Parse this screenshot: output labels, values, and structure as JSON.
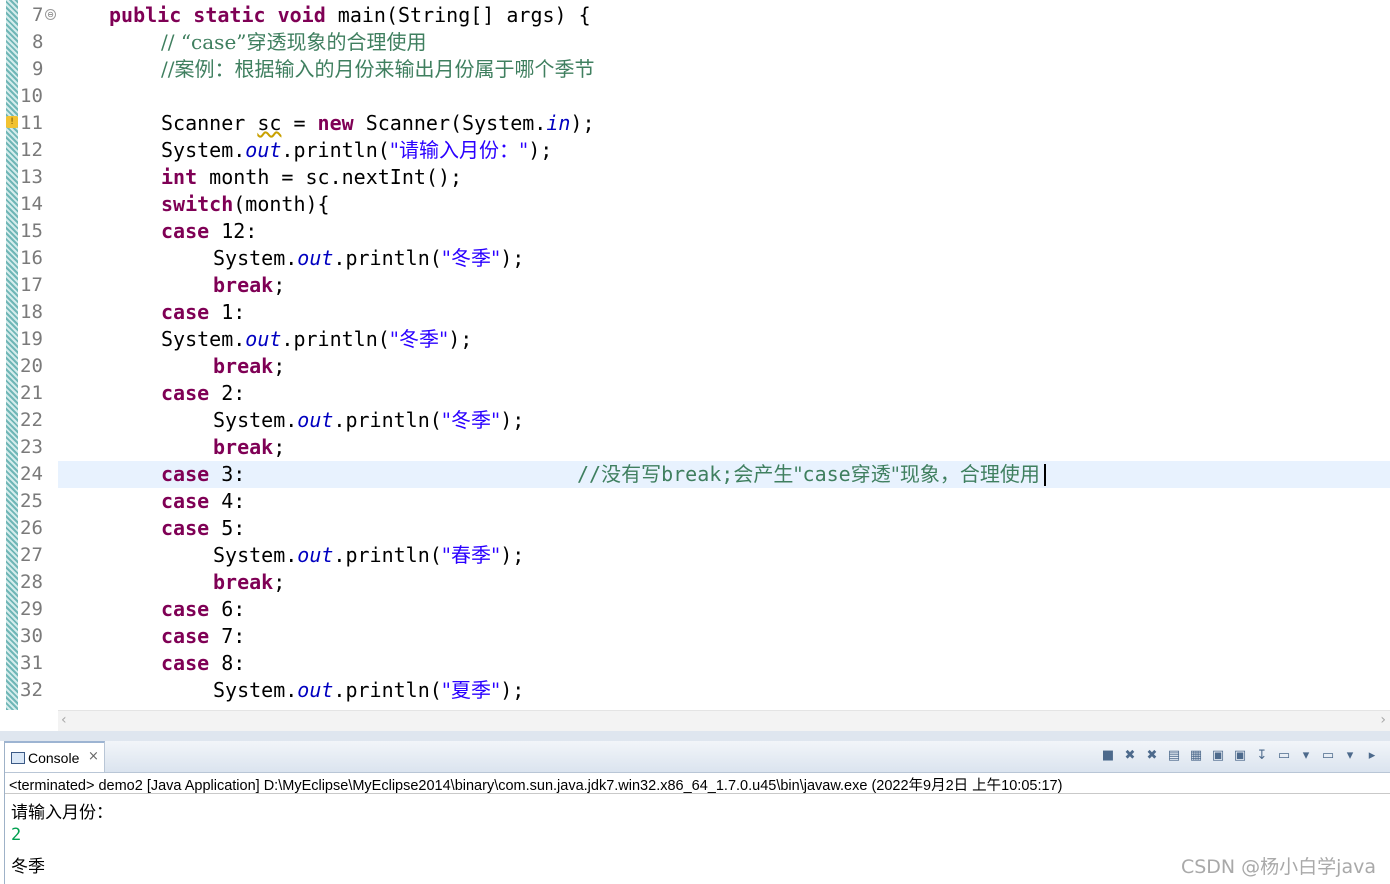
{
  "editor": {
    "line_numbers": [
      "7",
      "8",
      "9",
      "10",
      "11",
      "12",
      "13",
      "14",
      "15",
      "16",
      "17",
      "18",
      "19",
      "20",
      "21",
      "22",
      "23",
      "24",
      "25",
      "26",
      "27",
      "28",
      "29",
      "30",
      "31",
      "32"
    ],
    "tokens": {
      "public": "public",
      "static": "static",
      "void": "void",
      "main_sig": " main(String[] args) {",
      "c8": "// “case”穿透现象的合理使用",
      "c9": "//案例：根据输入的月份来输出月份属于哪个季节",
      "scanner_a": "Scanner ",
      "sc": "sc",
      " eq": " = ",
      "new": "new",
      "scanner_b": " Scanner(System.",
      "in": "in",
      "close": ");",
      "sys": "System.",
      "out": "out",
      "println_open": ".println(",
      "s12": "\"请输入月份：\"",
      "int": "int",
      "l13": " month = sc.nextInt();",
      "switch": "switch",
      "l14": "(month){",
      "case": "case",
      "n12": " 12:",
      "n1": " 1:",
      "n2": " 2:",
      "n3": " 3:",
      "n4": " 4:",
      "n5": " 5:",
      "n6": " 6:",
      "n7": " 7:",
      "n8": " 8:",
      "winter": "\"冬季\"",
      "spring": "\"春季\"",
      "summer": "\"夏季\"",
      "break": "break",
      "semi": ";",
      "c24_a": "//没有写",
      "c24_b": "break;",
      "c24_c": "会产生\"",
      "c24_d": "case",
      "c24_e": "穿透\"现象，合理使用"
    },
    "fold_icon": "⊖",
    "warn_icon": "!"
  },
  "hscroll": {
    "left": "‹",
    "right": "›"
  },
  "console": {
    "tab_label": "Console",
    "tab_close": "×",
    "toolbar": [
      "■",
      "✖",
      "✖",
      "▤",
      "▦",
      "▣",
      "▣",
      "↧",
      "▭",
      "▾",
      "▭",
      "▾",
      "▸"
    ],
    "status": "<terminated> demo2 [Java Application] D:\\MyEclipse\\MyEclipse2014\\binary\\com.sun.java.jdk7.win32.x86_64_1.7.0.u45\\bin\\javaw.exe (2022年9月2日 上午10:05:17)",
    "lines": [
      {
        "text": "请输入月份：",
        "color": "#000000"
      },
      {
        "text": "2",
        "color": "#00a050"
      },
      {
        "text": "冬季",
        "color": "#000000"
      }
    ]
  },
  "watermark": "CSDN @杨小白学java"
}
